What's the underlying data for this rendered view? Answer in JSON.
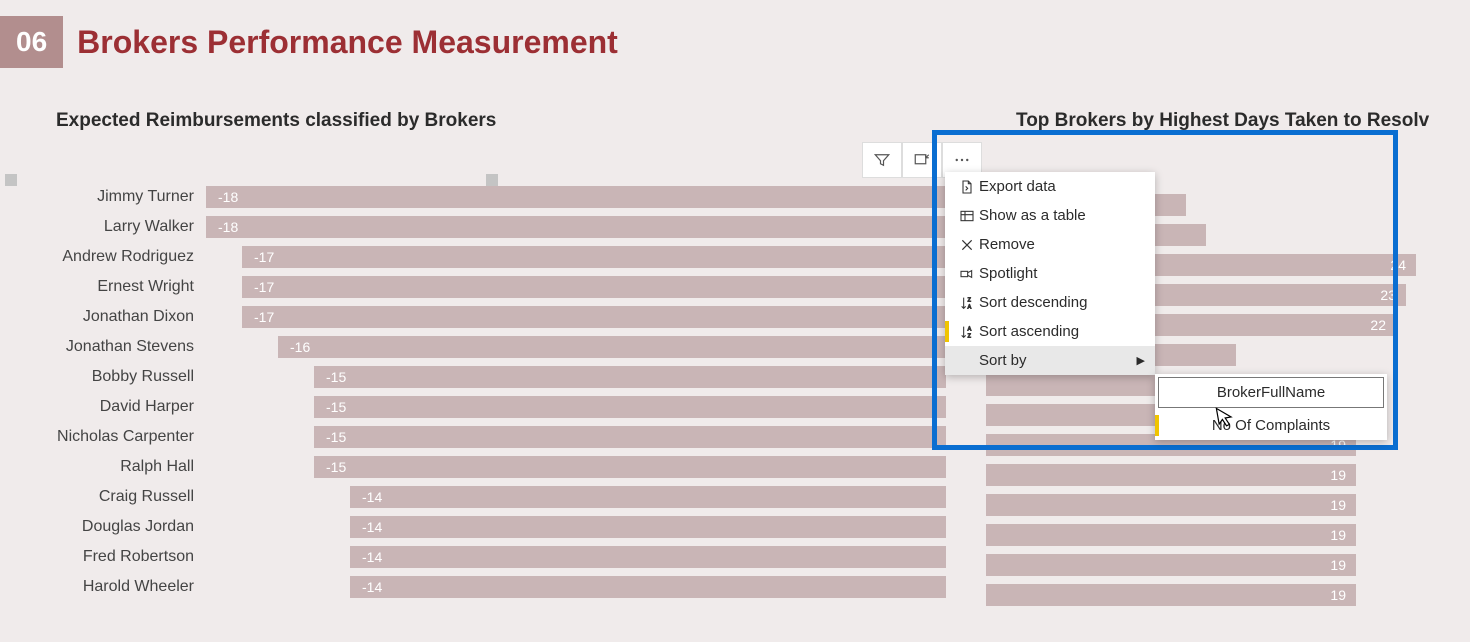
{
  "header": {
    "page_number": "06",
    "title": "Brokers Performance Measurement"
  },
  "left_chart": {
    "title": "Expected Reimbursements classified by Brokers"
  },
  "right_chart": {
    "title": "Top Brokers by Highest Days Taken to Resolv"
  },
  "toolbar": {
    "filter_tip": "Filter",
    "focus_tip": "Focus mode",
    "more_tip": "More options"
  },
  "context_menu": {
    "export": "Export data",
    "show_table": "Show as a table",
    "remove": "Remove",
    "spotlight": "Spotlight",
    "sort_desc": "Sort descending",
    "sort_asc": "Sort ascending",
    "sort_by": "Sort by"
  },
  "submenu": {
    "option1": "BrokerFullName",
    "option2": "No Of Complaints"
  },
  "chart_data": [
    {
      "type": "bar",
      "title": "Expected Reimbursements classified by Brokers",
      "orientation": "horizontal",
      "xlabel": "",
      "ylabel": "",
      "categories": [
        "Jimmy Turner",
        "Larry Walker",
        "Andrew Rodriguez",
        "Ernest Wright",
        "Jonathan Dixon",
        "Jonathan Stevens",
        "Bobby Russell",
        "David Harper",
        "Nicholas Carpenter",
        "Ralph Hall",
        "Craig Russell",
        "Douglas Jordan",
        "Fred Robertson",
        "Harold Wheeler"
      ],
      "values": [
        -18,
        -18,
        -17,
        -17,
        -17,
        -16,
        -15,
        -15,
        -15,
        -15,
        -14,
        -14,
        -14,
        -14
      ]
    },
    {
      "type": "bar",
      "title": "Top Brokers by Highest Days Taken to Resolve",
      "orientation": "horizontal",
      "xlabel": "",
      "ylabel": "",
      "categories_visible": false,
      "values": [
        null,
        null,
        24,
        23,
        22,
        null,
        null,
        19,
        19,
        19,
        19,
        19,
        19,
        19
      ]
    }
  ]
}
